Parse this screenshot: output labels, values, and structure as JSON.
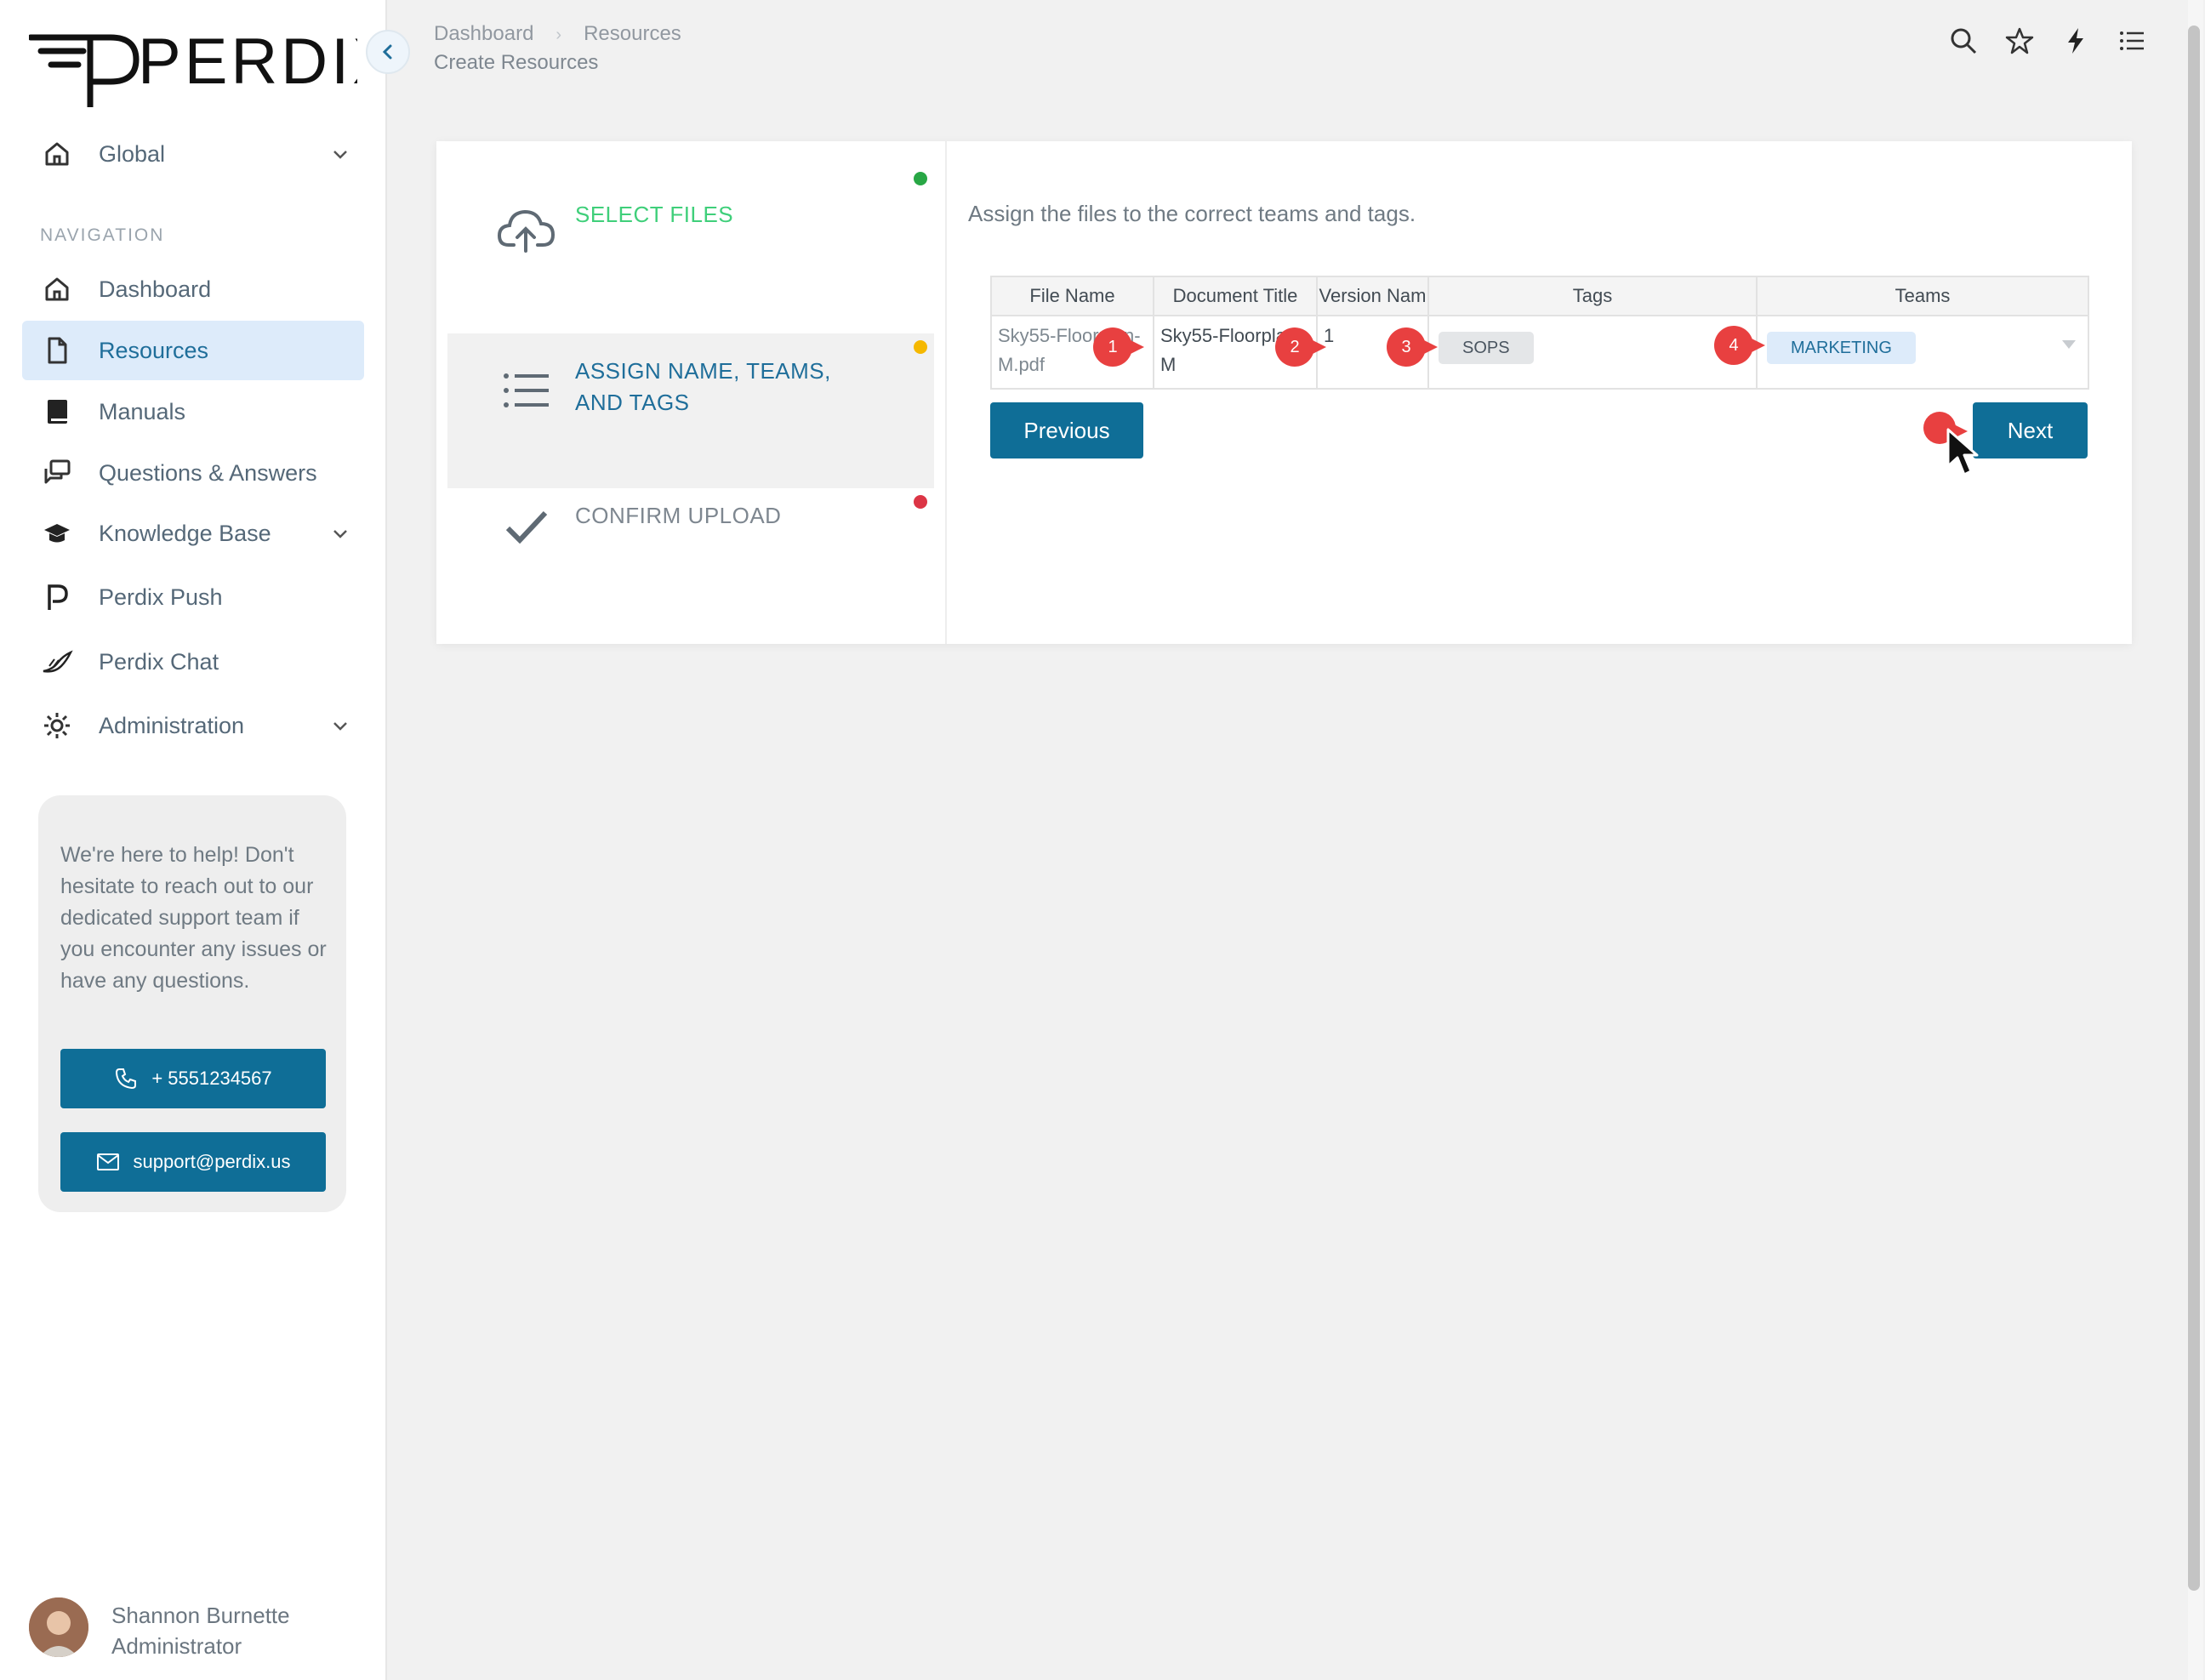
{
  "brand": {
    "logo_text": "PERDIX"
  },
  "sidebar": {
    "workspace": "Global",
    "nav_heading": "NAVIGATION",
    "items": [
      {
        "label": "Dashboard"
      },
      {
        "label": "Resources"
      },
      {
        "label": "Manuals"
      },
      {
        "label": "Questions & Answers"
      },
      {
        "label": "Knowledge Base"
      },
      {
        "label": "Perdix Push"
      },
      {
        "label": "Perdix Chat"
      },
      {
        "label": "Administration"
      }
    ],
    "help": {
      "text": "We're here to help! Don't hesitate to reach out to our dedicated support team if you encounter any issues or have any questions.",
      "phone": "+ 5551234567",
      "email": "support@perdix.us"
    },
    "user": {
      "name": "Shannon Burnette",
      "role": "Administrator"
    }
  },
  "header": {
    "breadcrumb": [
      "Dashboard",
      "Resources"
    ],
    "page_title": "Create Resources"
  },
  "wizard": {
    "steps": [
      {
        "label": "SELECT FILES",
        "status_color": "#28a745",
        "label_color": "#3fcf7a"
      },
      {
        "label": "ASSIGN NAME, TEAMS, AND TAGS",
        "status_color": "#f5b800",
        "label_color": "#1f6e9a"
      },
      {
        "label": "CONFIRM UPLOAD",
        "status_color": "#dc3545",
        "label_color": "#7e8790"
      }
    ],
    "description": "Assign the files to the correct teams and tags.",
    "table": {
      "columns": [
        "File Name",
        "Document Title",
        "Version Nam",
        "Tags",
        "Teams"
      ],
      "rows": [
        {
          "file_name": "Sky55-Floorplan-M.pdf",
          "document_title": "Sky55-Floorplan-M",
          "version": "1",
          "tag": "SOPS",
          "team": "MARKETING"
        }
      ]
    },
    "previous_label": "Previous",
    "next_label": "Next"
  },
  "markers": [
    "1",
    "2",
    "3",
    "4"
  ],
  "colors": {
    "accent": "#0f6e97",
    "active_nav_bg": "#ddebfa",
    "marker": "#e84040"
  }
}
